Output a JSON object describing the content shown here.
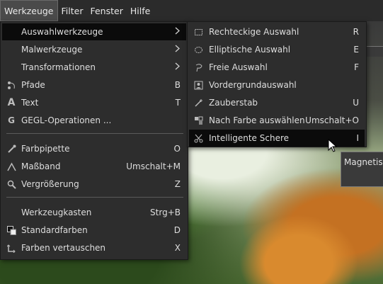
{
  "menubar": {
    "items": [
      "Werkzeuge",
      "Filter",
      "Fenster",
      "Hilfe"
    ],
    "active_index": 0
  },
  "main_menu": {
    "items": [
      {
        "label": "Auswahlwerkzeuge",
        "shortcut": "",
        "submenu": true,
        "icon": "none",
        "highlighted": true
      },
      {
        "label": "Malwerkzeuge",
        "shortcut": "",
        "submenu": true,
        "icon": "none"
      },
      {
        "label": "Transformationen",
        "shortcut": "",
        "submenu": true,
        "icon": "none"
      },
      {
        "label": "Pfade",
        "shortcut": "B",
        "icon": "paths-icon"
      },
      {
        "label": "Text",
        "shortcut": "T",
        "icon": "text-icon"
      },
      {
        "label": "GEGL-Operationen ...",
        "shortcut": "",
        "icon": "gegl-icon"
      },
      {
        "label": "Farbpipette",
        "shortcut": "O",
        "icon": "color-picker-icon"
      },
      {
        "label": "Maßband",
        "shortcut": "Umschalt+M",
        "icon": "measure-icon"
      },
      {
        "label": "Vergrößerung",
        "shortcut": "Z",
        "icon": "zoom-icon"
      },
      {
        "label": "Werkzeugkasten",
        "shortcut": "Strg+B",
        "icon": "none"
      },
      {
        "label": "Standardfarben",
        "shortcut": "D",
        "icon": "default-colors-icon"
      },
      {
        "label": "Farben vertauschen",
        "shortcut": "X",
        "icon": "swap-colors-icon"
      }
    ]
  },
  "submenu": {
    "items": [
      {
        "label": "Rechteckige Auswahl",
        "shortcut": "R",
        "icon": "rect-select-icon"
      },
      {
        "label": "Elliptische Auswahl",
        "shortcut": "E",
        "icon": "ellipse-select-icon"
      },
      {
        "label": "Freie Auswahl",
        "shortcut": "F",
        "icon": "free-select-icon"
      },
      {
        "label": "Vordergrundauswahl",
        "shortcut": "",
        "icon": "foreground-select-icon"
      },
      {
        "label": "Zauberstab",
        "shortcut": "U",
        "icon": "fuzzy-select-icon"
      },
      {
        "label": "Nach Farbe auswählen",
        "shortcut": "Umschalt+O",
        "icon": "select-by-color-icon"
      },
      {
        "label": "Intelligente Schere",
        "shortcut": "I",
        "icon": "scissors-icon",
        "highlighted": true
      }
    ]
  },
  "tooltip": {
    "text": "Magnetisc"
  },
  "colors": {
    "menu_bg": "#2d2d2d",
    "highlight": "#0b0b0b",
    "menubar_bg": "#2b2b2b"
  }
}
